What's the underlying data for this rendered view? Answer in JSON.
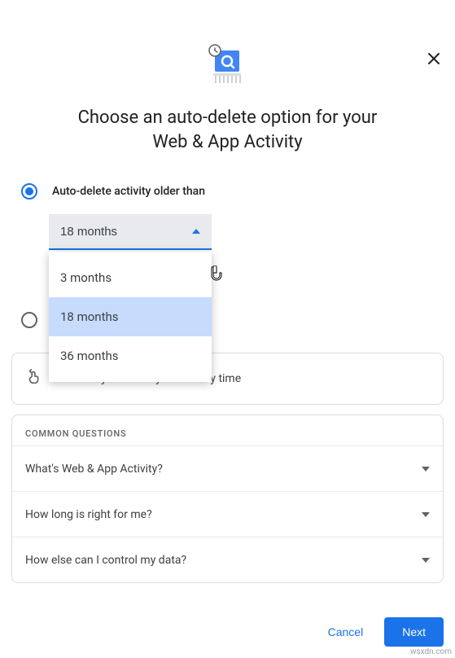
{
  "header": {
    "title_line1": "Choose an auto-delete option for your",
    "title_line2": "Web & App Activity"
  },
  "option_selected": {
    "label": "Auto-delete activity older than",
    "dropdown_value": "18 months",
    "menu": [
      "3 months",
      "18 months",
      "36 months"
    ],
    "highlighted_index": 1
  },
  "info_card": {
    "text": "can always manually delete any time"
  },
  "common_questions": {
    "header": "COMMON QUESTIONS",
    "items": [
      "What's Web & App Activity?",
      "How long is right for me?",
      "How else can I control my data?"
    ]
  },
  "footer": {
    "cancel": "Cancel",
    "next": "Next"
  },
  "watermark": "wsxdn.com"
}
